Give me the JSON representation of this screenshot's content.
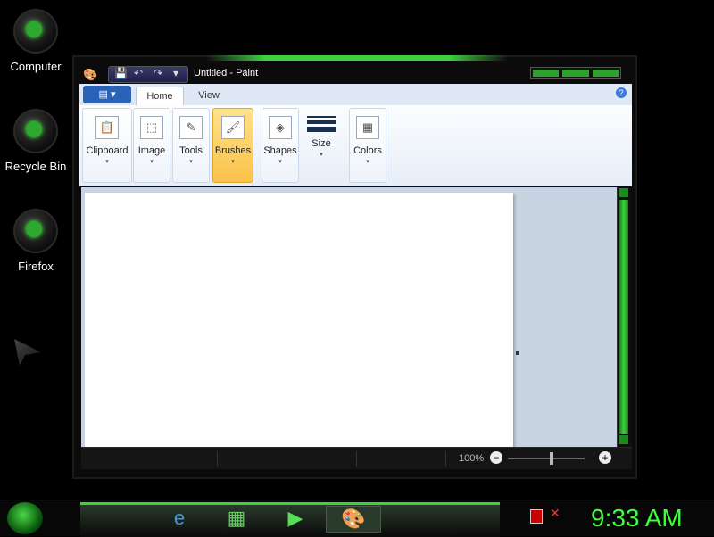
{
  "desktop": {
    "icons": [
      {
        "label": "Computer"
      },
      {
        "label": "Recycle Bin"
      },
      {
        "label": "Firefox"
      }
    ]
  },
  "window": {
    "title": "Untitled - Paint",
    "quick_access": {
      "save": "💾",
      "undo": "↶",
      "redo": "↷",
      "customize": "▾"
    },
    "ribbon": {
      "app_menu_label": "▤ ▾",
      "tabs": [
        {
          "label": "Home"
        },
        {
          "label": "View"
        }
      ],
      "help": "?",
      "groups": [
        {
          "label": "Clipboard",
          "icon": "📋"
        },
        {
          "label": "Image",
          "icon": "⬚"
        },
        {
          "label": "Tools",
          "icon": "✎"
        },
        {
          "label": "Brushes",
          "icon": "🖌"
        },
        {
          "label": "Shapes",
          "icon": "◈"
        },
        {
          "label": "Size",
          "icon": ""
        },
        {
          "label": "Colors",
          "icon": "▦"
        }
      ],
      "caret": "▾"
    },
    "statusbar": {
      "cursor_position": "",
      "selection_size": "",
      "image_size": "",
      "zoom": "100%",
      "zoom_out": "−",
      "zoom_in": "+"
    }
  },
  "taskbar": {
    "items": [
      {
        "icon": "e"
      },
      {
        "icon": "▦"
      },
      {
        "icon": "▶"
      },
      {
        "icon": "🎨"
      }
    ],
    "tray_x": "✕",
    "clock": "9:33 AM"
  }
}
